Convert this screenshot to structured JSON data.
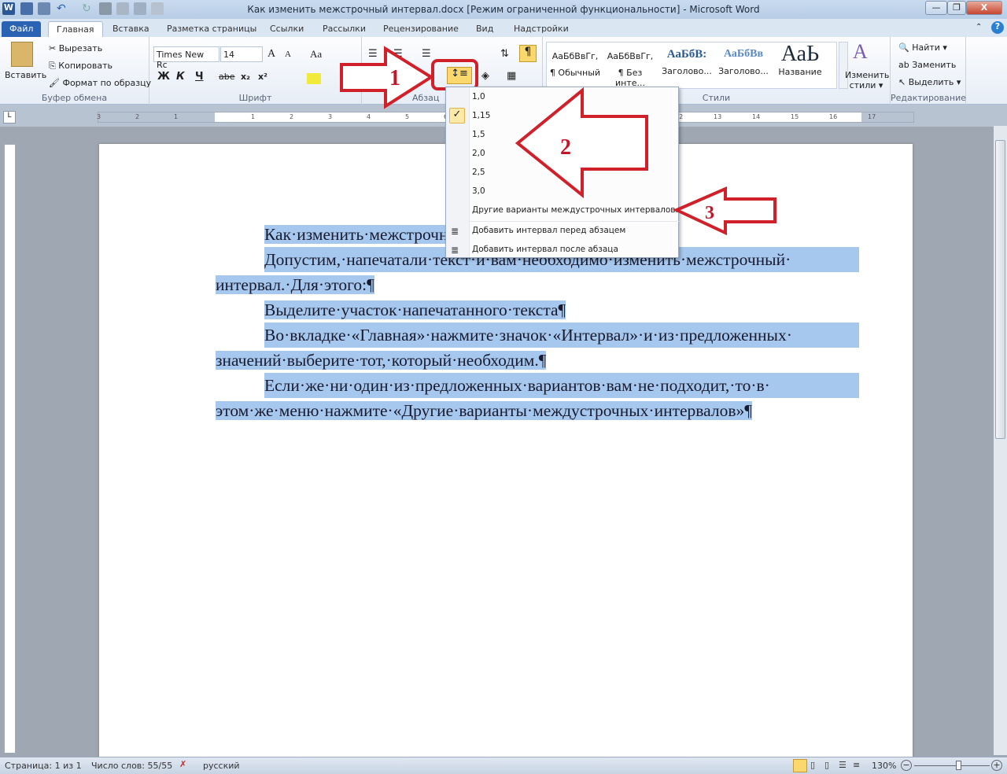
{
  "window": {
    "title": "Как изменить межстрочный интервал.docx [Режим ограниченной функциональности]  -  Microsoft Word",
    "minimize": "—",
    "restore": "❐",
    "close": "X"
  },
  "tabs": [
    "Файл",
    "Главная",
    "Вставка",
    "Разметка страницы",
    "Ссылки",
    "Рассылки",
    "Рецензирование",
    "Вид",
    "Надстройки"
  ],
  "clipboard": {
    "paste": "Вставить",
    "cut": "Вырезать",
    "copy": "Копировать",
    "format_painter": "Формат по образцу",
    "label": "Буфер обмена"
  },
  "font": {
    "name": "Times New Rc",
    "size": "14",
    "label": "Шрифт",
    "bold": "Ж",
    "italic": "К",
    "underline": "Ч",
    "strike": "abe",
    "sub": "x₂",
    "sup": "x²",
    "grow": "A",
    "shrink": "A",
    "case": "Aa"
  },
  "paragraph": {
    "label": "Абзац",
    "pilcrow": "¶"
  },
  "styles": {
    "label": "Стили",
    "items": [
      {
        "preview": "АаБбВвГг,",
        "name": "¶ Обычный"
      },
      {
        "preview": "АаБбВвГг,",
        "name": "¶ Без инте..."
      },
      {
        "preview": "АаБбВ:",
        "name": "Заголово..."
      },
      {
        "preview": "АаБбВв",
        "name": "Заголово..."
      },
      {
        "preview": "АаЬ",
        "name": "Название"
      }
    ],
    "change": "Изменить стили ▾"
  },
  "editing": {
    "label": "Редактирование",
    "find": "Найти ▾",
    "replace": "Заменить",
    "select": "Выделить ▾"
  },
  "line_spacing_menu": {
    "options": [
      "1,0",
      "1,15",
      "1,5",
      "2,0",
      "2,5",
      "3,0"
    ],
    "selected": "1,15",
    "more": "Другие варианты междустрочных интервалов...",
    "before": "Добавить интервал перед абзацем",
    "after": "Добавить интервал после абзаца"
  },
  "annotations": [
    "1",
    "2",
    "3"
  ],
  "ruler": {
    "ticks": [
      "3",
      "2",
      "1",
      "1",
      "2",
      "3",
      "4",
      "5",
      "6",
      "7",
      "8",
      "9",
      "10",
      "11",
      "12",
      "13",
      "14",
      "15",
      "16",
      "17"
    ]
  },
  "document": {
    "lines": [
      "Как·изменить·межстрочный·интервал·в·Word¶",
      "Допустим,·напечатали·текст·и·вам·необходимо·изменить·межстрочный·",
      "интервал.·Для·этого:¶",
      "Выделите·участок·напечатанного·текста¶",
      "Во·вкладке·«Главная»·нажмите·значок·«Интервал»·и·из·предложенных·",
      "значений·выберите·тот,·который·необходим.¶",
      "Если·же·ни·один·из·предложенных·вариантов·вам·не·подходит,·то·в·",
      "этом·же·меню·нажмите·«Другие·варианты·междустрочных·интервалов»¶"
    ]
  },
  "status": {
    "page": "Страница: 1 из 1",
    "words": "Число слов: 55/55",
    "lang": "русский",
    "zoom": "130%",
    "zoom_percent": 130
  },
  "colors": {
    "accent": "#2a63b4",
    "selection": "#a6c8ee",
    "annotation": "#d0202a"
  }
}
